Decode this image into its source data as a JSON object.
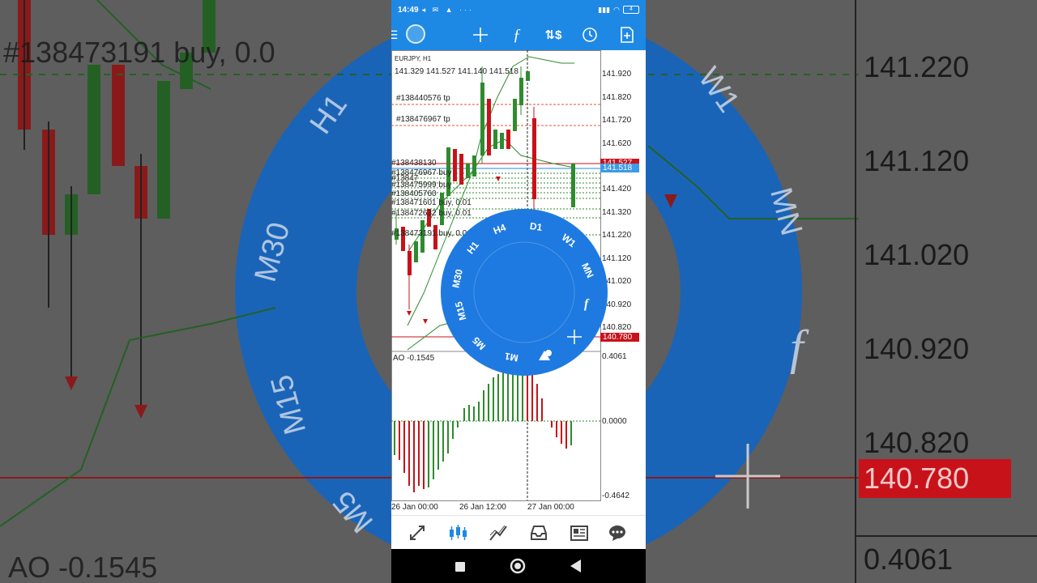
{
  "background": {
    "prices": [
      "141.220",
      "141.120",
      "141.020",
      "140.920",
      "140.820",
      "140.780",
      "0.4061"
    ],
    "order_text": "#138473191 buy, 0.0",
    "ao_text": "AO -0.1545",
    "wheel_labels": [
      "H1",
      "M30",
      "M15",
      "M5",
      "W1",
      "MN",
      "f"
    ]
  },
  "status_bar": {
    "time": "14:49",
    "icons": "◂ ✉ ▲ ···",
    "battery": "4"
  },
  "toolbar": {
    "items": [
      "crosshair-icon",
      "indicators-icon",
      "trade-icon",
      "period-icon",
      "add-object-icon"
    ]
  },
  "chart": {
    "symbol": "EURJPY, H1",
    "ohlc": "141.329 141.527 141.140 141.518",
    "price_axis": [
      "141.920",
      "141.820",
      "141.720",
      "141.620",
      "141.520",
      "141.420",
      "141.320",
      "141.220",
      "141.120",
      "141.020",
      "140.920",
      "140.820"
    ],
    "ask_tag": "141.527",
    "bid_tag": "141.518",
    "line_tag": "140.780",
    "orders": [
      "#138440576 tp",
      "#138476967 tp",
      "#138438130",
      "#138476967 buy",
      "#13847",
      "#138475999 buy",
      "#138405760",
      "#138471601 buy, 0.01",
      "#138472632 buy, 0.01",
      "#138473191 buy, 0.01"
    ],
    "oscillator": {
      "name": "AO -0.1545",
      "axis": [
        "0.4061",
        "0.0000",
        "-0.4642"
      ]
    },
    "time_axis": [
      "26 Jan 00:00",
      "26 Jan 12:00",
      "27 Jan 00:00"
    ]
  },
  "timeframe_wheel": {
    "items": [
      "M1",
      "M5",
      "M15",
      "M30",
      "H1",
      "H4",
      "D1",
      "W1",
      "MN"
    ],
    "function_label": "f"
  },
  "bottom_nav": [
    "quotes-icon",
    "chart-icon",
    "trade-icon",
    "history-icon",
    "news-icon",
    "messages-icon"
  ],
  "colors": {
    "accent": "#1e88e5",
    "bull": "#2e8b2e",
    "bear": "#c8121a",
    "wheel": "#1e7ae0"
  }
}
